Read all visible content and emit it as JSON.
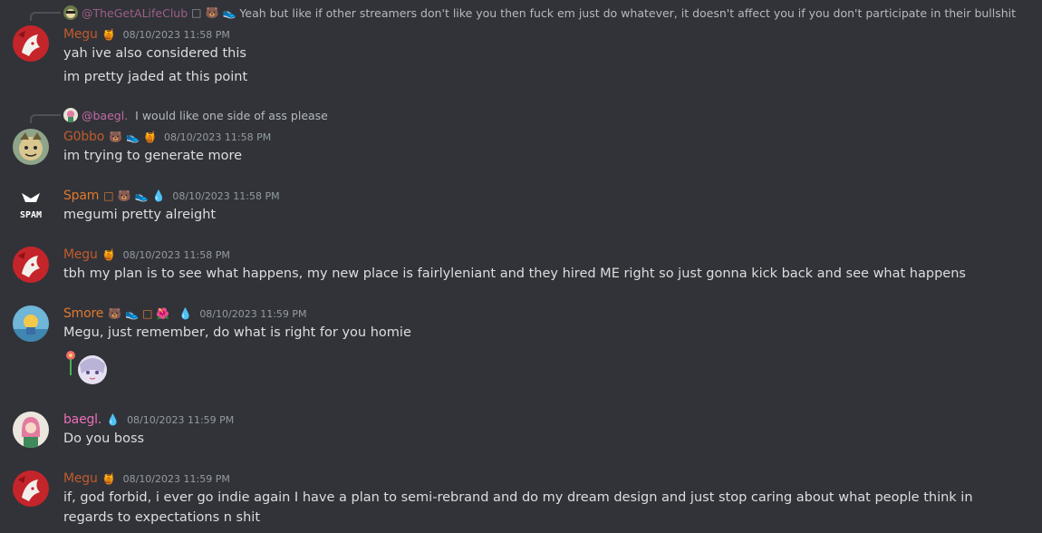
{
  "messages": [
    {
      "reply": {
        "author": "@TheGetALifeClub",
        "author_badges": [
          "□",
          "🐻",
          "👟"
        ],
        "text": "Yeah but like if other streamers don't like you then fuck em just do whatever, it doesn't affect you if you don't participate in their bullshit"
      },
      "author": "Megu",
      "badges": [
        "🍯"
      ],
      "timestamp": "08/10/2023 11:58 PM",
      "lines": [
        "yah ive also considered this",
        "im pretty jaded at this point"
      ]
    },
    {
      "reply": {
        "author": "@baegl.",
        "text": "I would like one side of ass please"
      },
      "author": "G0bbo",
      "badges": [
        "🐻",
        "👟",
        "🍯"
      ],
      "timestamp": "08/10/2023 11:58 PM",
      "lines": [
        "im trying to generate more"
      ]
    },
    {
      "author": "Spam",
      "badges": [
        "□",
        "🐻",
        "👟",
        "💧"
      ],
      "timestamp": "08/10/2023 11:58 PM",
      "lines": [
        "megumi pretty alreight"
      ],
      "avatar_text": "SPAM"
    },
    {
      "author": "Megu",
      "badges": [
        "🍯"
      ],
      "timestamp": "08/10/2023 11:58 PM",
      "lines": [
        "tbh my plan is to see what happens, my new place is fairlyleniant and they hired ME right so just gonna kick back and see what happens"
      ]
    },
    {
      "author": "Smore",
      "badges": [
        "🐻",
        "👟",
        "□",
        "🌺",
        "💧"
      ],
      "timestamp": "08/10/2023 11:59 PM",
      "lines": [
        "Megu, just remember, do what is right for you homie"
      ],
      "sticker": "flower-girl-sticker"
    },
    {
      "author": "baegl.",
      "badges": [
        "💧"
      ],
      "timestamp": "08/10/2023 11:59 PM",
      "lines": [
        "Do you boss"
      ]
    },
    {
      "author": "Megu",
      "badges": [
        "🍯"
      ],
      "timestamp": "08/10/2023 11:59 PM",
      "lines": [
        "if, god forbid, i ever go indie again I have a plan to semi-rebrand and do my dream design and just stop caring about what people think in regards to expectations n shit"
      ]
    }
  ],
  "colors": {
    "background": "#313338",
    "text": "#dbdee1",
    "timestamp": "#949ba4",
    "megu": "#c05b2c",
    "spam": "#e0792d",
    "baegl": "#eb6fb8"
  }
}
